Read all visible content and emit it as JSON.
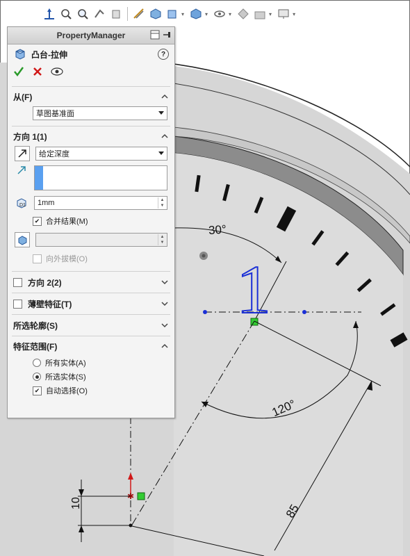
{
  "colors": {
    "sketch_blue": "#1a2fd6",
    "relation_green": "#33cc33",
    "ok_green": "#2a9a2a",
    "cancel_red": "#d01818",
    "selection_blue": "#5aa0f0"
  },
  "property_manager": {
    "title": "PropertyManager",
    "feature_name": "凸台-拉伸",
    "help": "?",
    "actions": [
      "ok-check-icon",
      "cancel-x-icon",
      "preview-eye-icon"
    ]
  },
  "from_group": {
    "label": "从(F)",
    "start_condition": "草图基准面"
  },
  "direction1": {
    "label": "方向 1(1)",
    "end_condition": "给定深度",
    "depth": "1mm",
    "merge_result": "合并结果(M)",
    "merge_checked": true,
    "draft_outward": "向外拔模(O)",
    "draft_checked": false
  },
  "direction2": {
    "label": "方向 2(2)",
    "checked": false
  },
  "thin_feature": {
    "label": "薄壁特征(T)",
    "checked": false
  },
  "selected_contours": {
    "label": "所选轮廓(S)"
  },
  "feature_scope": {
    "label": "特征范围(F)",
    "options": [
      "所有实体(A)",
      "所选实体(S)"
    ],
    "selected": "所选实体(S)",
    "auto_select": "自动选择(O)",
    "auto_checked": true
  },
  "graphics": {
    "dim_30": "30°",
    "dim_120": "120°",
    "dim_85": "85",
    "dim_10": "10",
    "sketch_number": "1"
  },
  "toolbar_icons": [
    "coordinate-icon",
    "zoom-fit-icon",
    "zoom-area-icon",
    "previous-view-icon",
    "section-view-icon",
    "dynamic-annotation-icon",
    "view-orientation-icon",
    "display-style-icon",
    "hide-show-icon",
    "edit-appearance-icon",
    "apply-scene-icon",
    "view-settings-icon"
  ]
}
